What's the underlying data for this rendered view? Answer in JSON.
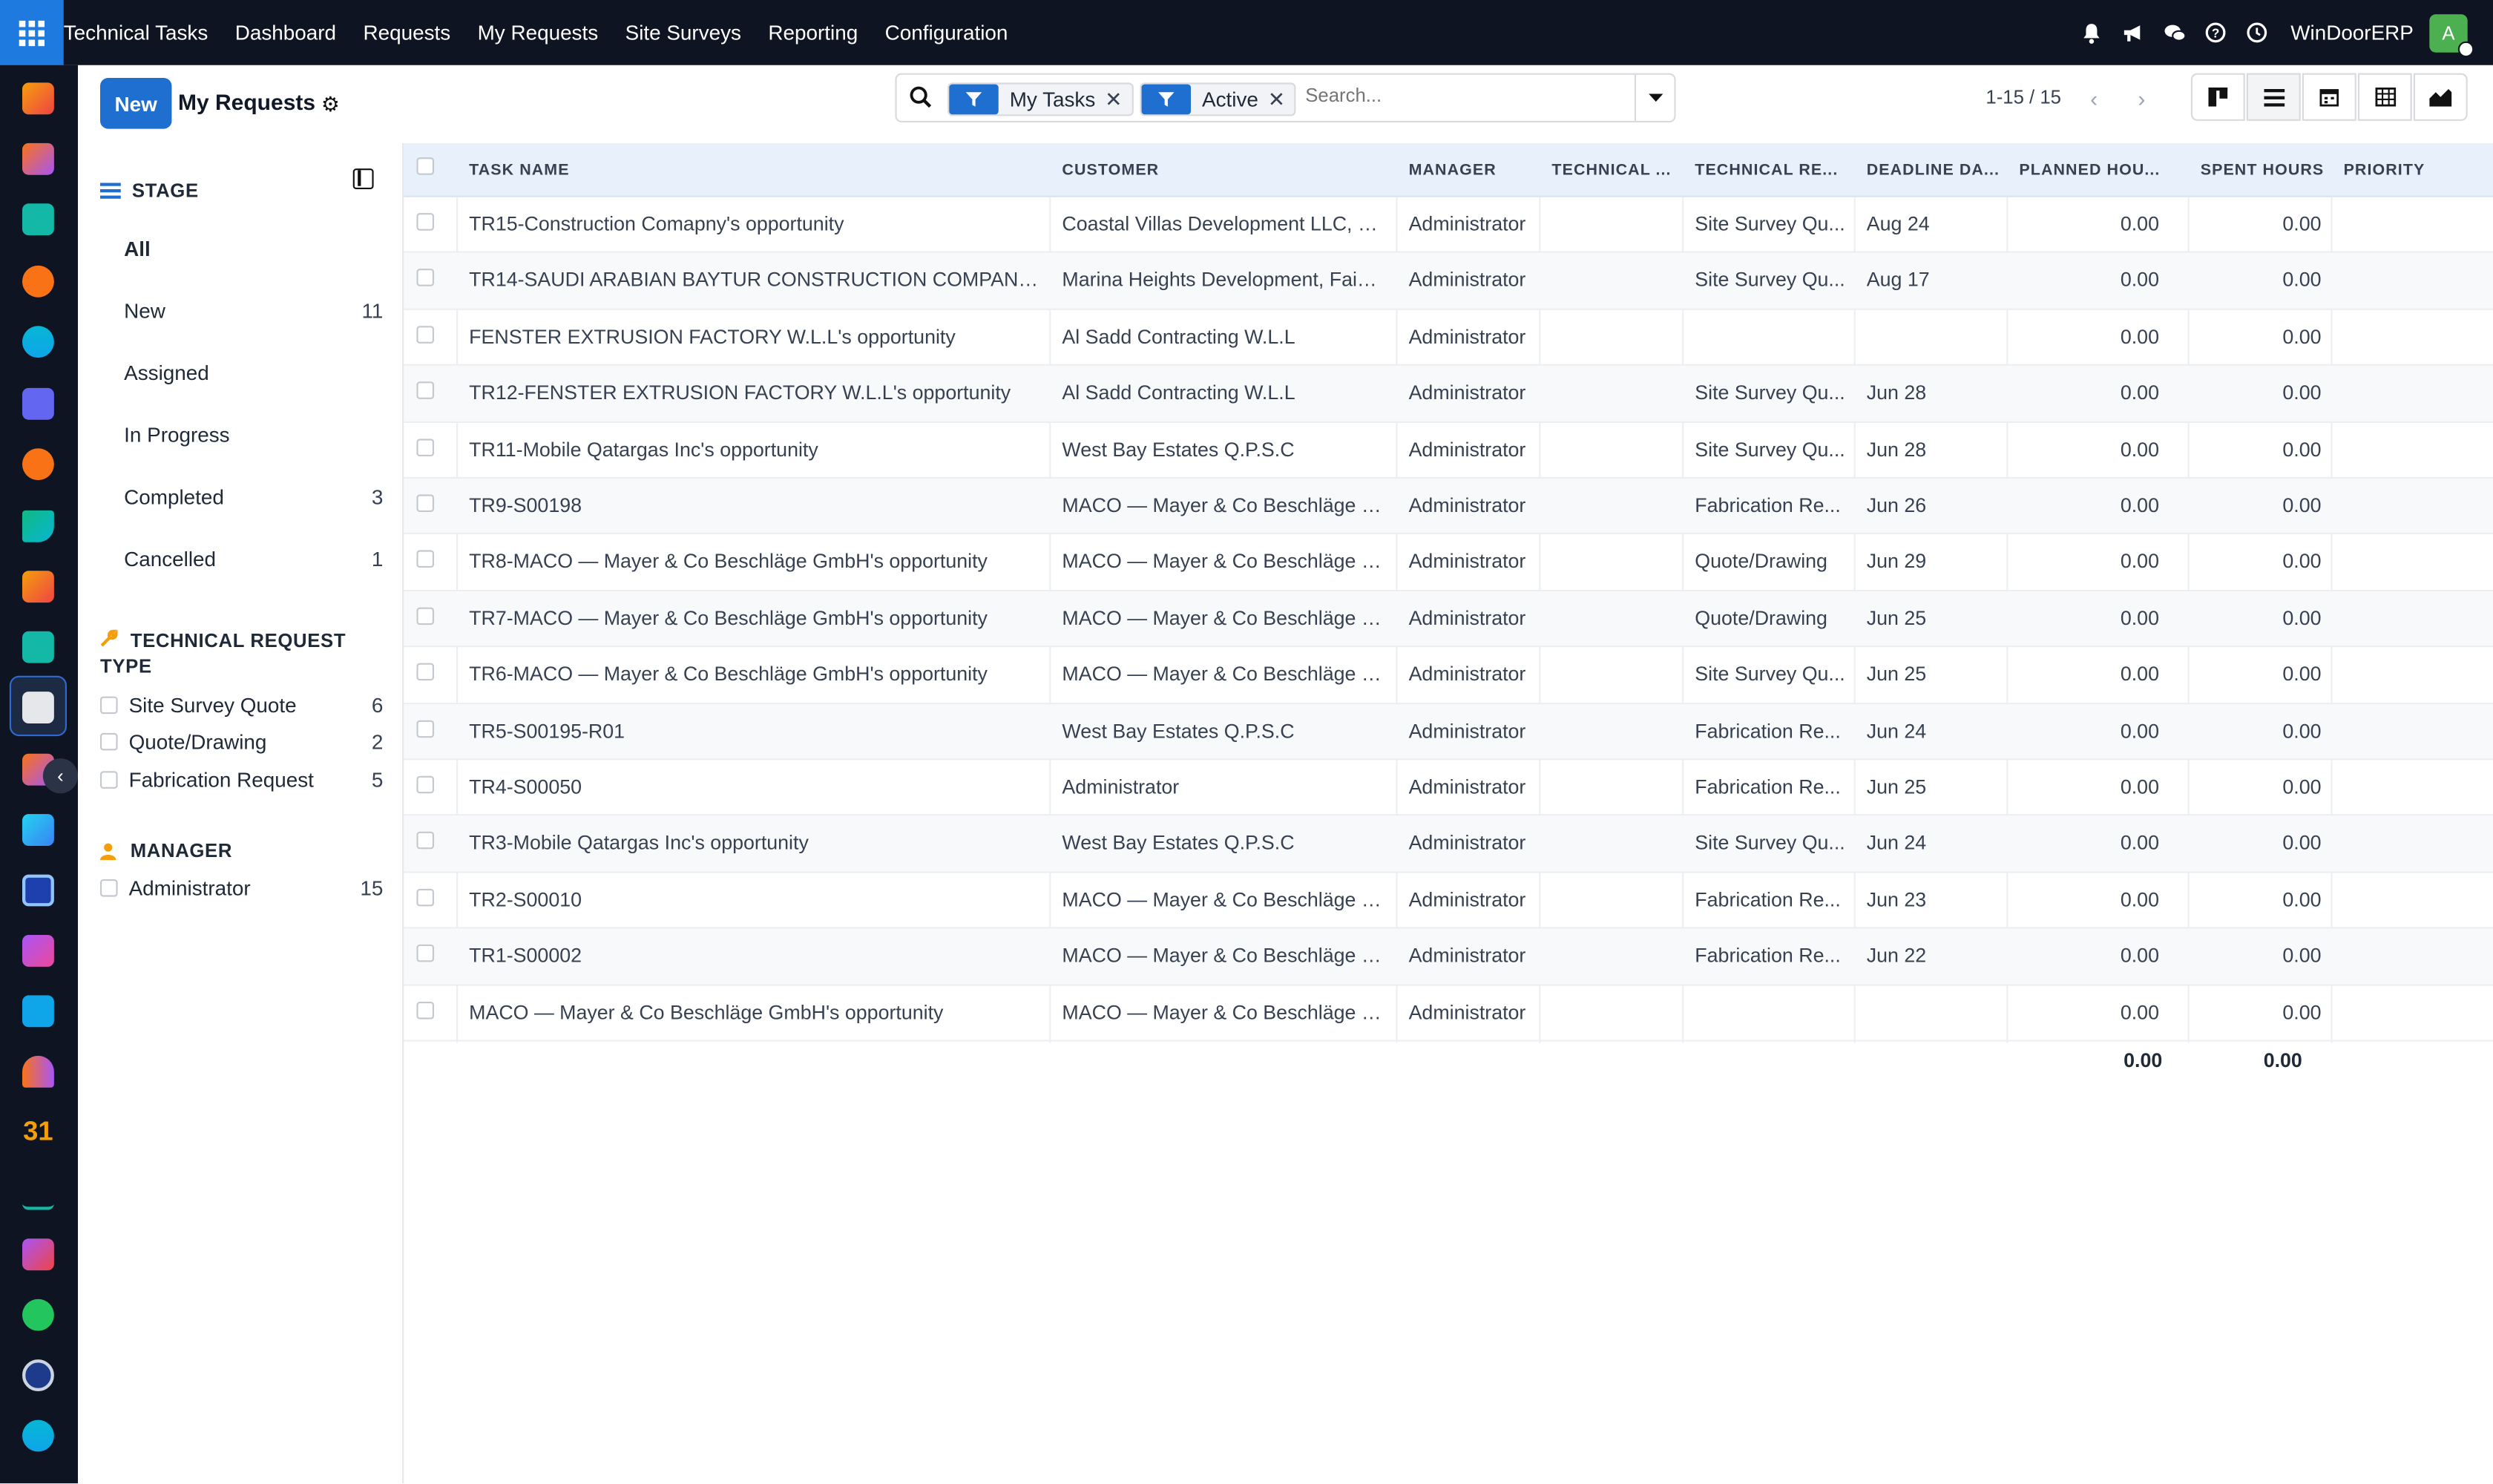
{
  "navbar": {
    "brand": "Technical Tasks",
    "menu": [
      "Dashboard",
      "Requests",
      "My Requests",
      "Site Surveys",
      "Reporting",
      "Configuration"
    ],
    "company": "WinDoorERP",
    "avatar_letter": "A"
  },
  "control_panel": {
    "new_label": "New",
    "title": "My Requests",
    "facets": [
      "My Tasks",
      "Active"
    ],
    "search_placeholder": "Search...",
    "pager": "1-15 / 15"
  },
  "search_panel": {
    "stage_title": "STAGE",
    "stages": [
      {
        "label": "All",
        "count": ""
      },
      {
        "label": "New",
        "count": "11"
      },
      {
        "label": "Assigned",
        "count": ""
      },
      {
        "label": "In Progress",
        "count": ""
      },
      {
        "label": "Completed",
        "count": "3"
      },
      {
        "label": "Cancelled",
        "count": "1"
      }
    ],
    "type_title_1": "TECHNICAL REQUEST",
    "type_title_2": "TYPE",
    "types": [
      {
        "label": "Site Survey Quote",
        "count": "6"
      },
      {
        "label": "Quote/Drawing",
        "count": "2"
      },
      {
        "label": "Fabrication Request",
        "count": "5"
      }
    ],
    "manager_title": "MANAGER",
    "managers": [
      {
        "label": "Administrator",
        "count": "15"
      }
    ]
  },
  "table": {
    "headers": [
      "TASK NAME",
      "CUSTOMER",
      "MANAGER",
      "TECHNICAL ...",
      "TECHNICAL RE...",
      "DEADLINE DA...",
      "PLANNED HOU...",
      "SPENT HOURS",
      "PRIORITY"
    ],
    "rows": [
      {
        "task": "TR15-Construction Comapny's opportunity",
        "customer": "Coastal Villas Development LLC, Ph...",
        "manager": "Administrator",
        "tech": "",
        "type": "Site Survey Qu...",
        "deadline": "Aug 24",
        "planned": "0.00",
        "spent": "0.00"
      },
      {
        "task": "TR14-SAUDI ARABIAN BAYTUR CONSTRUCTION COMPANY's ...",
        "customer": "Marina Heights Development, Faisa...",
        "manager": "Administrator",
        "tech": "",
        "type": "Site Survey Qu...",
        "deadline": "Aug 17",
        "planned": "0.00",
        "spent": "0.00"
      },
      {
        "task": "FENSTER EXTRUSION FACTORY W.L.L's opportunity",
        "customer": "Al Sadd Contracting W.L.L",
        "manager": "Administrator",
        "tech": "",
        "type": "",
        "deadline": "",
        "planned": "0.00",
        "spent": "0.00"
      },
      {
        "task": "TR12-FENSTER EXTRUSION FACTORY W.L.L's opportunity",
        "customer": "Al Sadd Contracting W.L.L",
        "manager": "Administrator",
        "tech": "",
        "type": "Site Survey Qu...",
        "deadline": "Jun 28",
        "planned": "0.00",
        "spent": "0.00"
      },
      {
        "task": "TR11-Mobile Qatargas Inc's opportunity",
        "customer": "West Bay Estates Q.P.S.C",
        "manager": "Administrator",
        "tech": "",
        "type": "Site Survey Qu...",
        "deadline": "Jun 28",
        "planned": "0.00",
        "spent": "0.00"
      },
      {
        "task": "TR9-S00198",
        "customer": "MACO — Mayer & Co Beschläge G...",
        "manager": "Administrator",
        "tech": "",
        "type": "Fabrication Re...",
        "deadline": "Jun 26",
        "planned": "0.00",
        "spent": "0.00"
      },
      {
        "task": "TR8-MACO — Mayer & Co Beschläge GmbH's opportunity",
        "customer": "MACO — Mayer & Co Beschläge G...",
        "manager": "Administrator",
        "tech": "",
        "type": "Quote/Drawing",
        "deadline": "Jun 29",
        "planned": "0.00",
        "spent": "0.00"
      },
      {
        "task": "TR7-MACO — Mayer & Co Beschläge GmbH's opportunity",
        "customer": "MACO — Mayer & Co Beschläge G...",
        "manager": "Administrator",
        "tech": "",
        "type": "Quote/Drawing",
        "deadline": "Jun 25",
        "planned": "0.00",
        "spent": "0.00"
      },
      {
        "task": "TR6-MACO — Mayer & Co Beschläge GmbH's opportunity",
        "customer": "MACO — Mayer & Co Beschläge G...",
        "manager": "Administrator",
        "tech": "",
        "type": "Site Survey Qu...",
        "deadline": "Jun 25",
        "planned": "0.00",
        "spent": "0.00"
      },
      {
        "task": "TR5-S00195-R01",
        "customer": "West Bay Estates Q.P.S.C",
        "manager": "Administrator",
        "tech": "",
        "type": "Fabrication Re...",
        "deadline": "Jun 24",
        "planned": "0.00",
        "spent": "0.00"
      },
      {
        "task": "TR4-S00050",
        "customer": "Administrator",
        "manager": "Administrator",
        "tech": "",
        "type": "Fabrication Re...",
        "deadline": "Jun 25",
        "planned": "0.00",
        "spent": "0.00"
      },
      {
        "task": "TR3-Mobile Qatargas Inc's opportunity",
        "customer": "West Bay Estates Q.P.S.C",
        "manager": "Administrator",
        "tech": "",
        "type": "Site Survey Qu...",
        "deadline": "Jun 24",
        "planned": "0.00",
        "spent": "0.00"
      },
      {
        "task": "TR2-S00010",
        "customer": "MACO — Mayer & Co Beschläge G...",
        "manager": "Administrator",
        "tech": "",
        "type": "Fabrication Re...",
        "deadline": "Jun 23",
        "planned": "0.00",
        "spent": "0.00"
      },
      {
        "task": "TR1-S00002",
        "customer": "MACO — Mayer & Co Beschläge G...",
        "manager": "Administrator",
        "tech": "",
        "type": "Fabrication Re...",
        "deadline": "Jun 22",
        "planned": "0.00",
        "spent": "0.00"
      },
      {
        "task": "MACO — Mayer & Co Beschläge GmbH's opportunity",
        "customer": "MACO — Mayer & Co Beschläge G...",
        "manager": "Administrator",
        "tech": "",
        "type": "",
        "deadline": "",
        "planned": "0.00",
        "spent": "0.00"
      }
    ],
    "totals": {
      "planned": "0.00",
      "spent": "0.00"
    }
  },
  "colors": {
    "navbar_bg": "#0f1422",
    "primary": "#1f6fd1",
    "header_bg": "#e8f1fb"
  },
  "rail_icons": [
    "sales-icon",
    "crm-icon",
    "contacts-icon",
    "discuss-icon",
    "website-icon",
    "mail-icon",
    "livechat-icon",
    "planning-icon",
    "reports-icon",
    "employees-icon",
    "technical-tasks-icon",
    "inventory-icon",
    "approvals-icon",
    "helpdesk-icon",
    "purchase-icon",
    "invoicing-icon",
    "team-icon",
    "calendar-icon",
    "sign-icon",
    "dashboards-icon",
    "whatsapp-icon",
    "timer-icon",
    "website-icon"
  ]
}
